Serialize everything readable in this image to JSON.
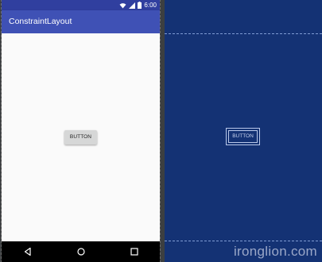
{
  "status_bar": {
    "time": "6:00",
    "icons": [
      "wifi-icon",
      "signal-icon",
      "battery-icon"
    ]
  },
  "app_bar": {
    "title": "ConstraintLayout"
  },
  "content": {
    "button_label": "BUTTON"
  },
  "nav_bar": {
    "icons": [
      "back-icon",
      "home-icon",
      "recents-icon"
    ]
  },
  "blueprint": {
    "button_label": "BUTTON"
  },
  "watermark": "ironglion.com",
  "colors": {
    "status_bar": "#303f9f",
    "app_bar": "#3f51b5",
    "blueprint_bg": "#143274",
    "button": "#d6d7d7"
  }
}
